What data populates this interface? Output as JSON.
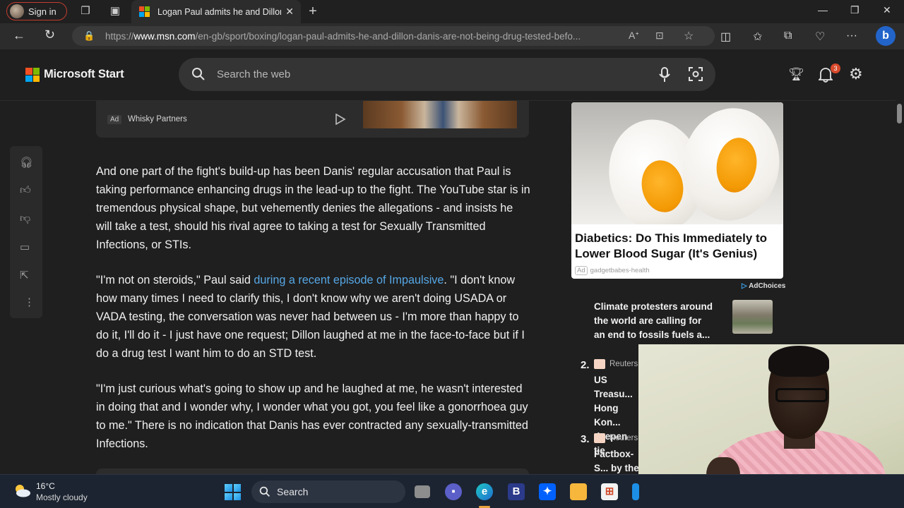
{
  "browser": {
    "signin_label": "Sign in",
    "tab_title": "Logan Paul admits he and Dillon",
    "url_prefix": "https://",
    "url_host": "www.msn.com",
    "url_path": "/en-gb/sport/boxing/logan-paul-admits-he-and-dillon-danis-are-not-being-drug-tested-befo..."
  },
  "header": {
    "brand": "Microsoft Start",
    "search_placeholder": "Search the web",
    "notification_count": "3"
  },
  "article": {
    "ad_label": "Ad",
    "ad_sponsor": "Whisky Partners",
    "p1": "And one part of the fight's build-up has been Danis' regular accusation that Paul is taking performance enhancing drugs in the lead-up to the fight. The YouTube star is in tremendous physical shape, but vehemently denies the allegations - and insists he will take a test, should his rival agree to taking a test for Sexually Transmitted Infections, or STIs.",
    "p2_start": "\"I'm not on steroids,\" Paul said ",
    "p2_link": "during a recent episode of Impaulsive",
    "p2_end": ". \"I don't know how many times I need to clarify this, I don't know why we aren't doing USADA or VADA testing, the conversation was never had between us - I'm more than happy to do it, I'll do it - I just have one request; Dillon laughed at me in the face-to-face but if I do a drug test I want him to do an STD test.",
    "p3": "\"I'm just curious what's going to show up and he laughed at me, he wasn't interested in doing that and I wonder why, I wonder what you got, you feel like a gonorrhoea guy to me.\" There is no indication that Danis has ever contracted any sexually-transmitted Infections."
  },
  "right_rail": {
    "ad_headline": "Diabetics: Do This Immediately to Lower Blood Sugar (It's Genius)",
    "ad_label": "Ad",
    "ad_source": "gadgetbabes-health",
    "adchoices": "AdChoices",
    "trending": [
      {
        "num": "",
        "source": "",
        "headline": "Climate protesters around the world are calling for an end to fossils fuels a..."
      },
      {
        "num": "2.",
        "source": "Reuters",
        "headline": "US Treasu... Hong Kon... deepen tie..."
      },
      {
        "num": "3.",
        "source": "Reuters",
        "headline": "Factbox-S... by the num..."
      }
    ]
  },
  "taskbar": {
    "temperature": "16°C",
    "condition": "Mostly cloudy",
    "search_placeholder": "Search"
  },
  "colors": {
    "accent_link": "#56a7e5",
    "notification_badge": "#d84a2b",
    "ms_red": "#f25022",
    "ms_green": "#7fba00",
    "ms_blue": "#00a4ef",
    "ms_yellow": "#ffb900"
  }
}
